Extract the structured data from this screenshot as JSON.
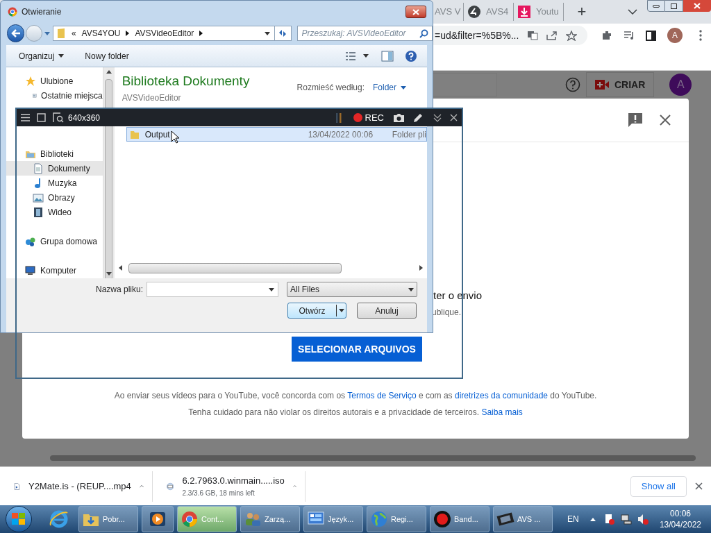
{
  "browser": {
    "tabs": [
      {
        "label": "AVS V",
        "kind": "plain",
        "selected": false
      },
      {
        "label": "AVS4",
        "kind": "badge",
        "selected": false
      },
      {
        "label": "Youtu",
        "kind": "download",
        "selected": false
      }
    ],
    "new_tab": "+",
    "url": "=ud&filter=%5B%...",
    "profile": "A"
  },
  "youtube": {
    "create_button": "CRIAR",
    "avatar": "A",
    "upload_dialog": {
      "line_1": "ter o envio",
      "line_2": "ublique.",
      "select_button": "SELECIONAR ARQUIVOS",
      "footer": [
        [
          {
            "kind": "text",
            "text": "Ao enviar seus vídeos para o YouTube, você concorda com os "
          },
          {
            "kind": "link",
            "text": "Termos de Serviço"
          },
          {
            "kind": "text",
            "text": " e com as "
          },
          {
            "kind": "link",
            "text": "diretrizes da comunidade"
          },
          {
            "kind": "text",
            "text": " do YouTube."
          }
        ],
        [
          {
            "kind": "text",
            "text": "Tenha cuidado para não violar os direitos autorais e a privacidade de terceiros. "
          },
          {
            "kind": "link",
            "text": "Saiba mais"
          }
        ]
      ]
    }
  },
  "open_dialog": {
    "title": "Otwieranie",
    "path_overflow": "«",
    "path": [
      "AVS4YOU",
      "AVSVideoEditor"
    ],
    "search_placeholder": "Przeszukaj: AVSVideoEditor",
    "toolbar": [
      "Organizuj",
      "Nowy folder"
    ],
    "nav": [
      {
        "label": "Ulubione",
        "kind": "star",
        "selected": false,
        "children": [
          {
            "label": "Ostatnie miejsca",
            "kind": "recent",
            "selected": false
          }
        ]
      },
      {
        "label": "Biblioteki",
        "kind": "library",
        "selected": false,
        "children": [
          {
            "label": "Dokumenty",
            "kind": "document",
            "selected": true
          },
          {
            "label": "Muzyka",
            "kind": "music",
            "selected": false
          },
          {
            "label": "Obrazy",
            "kind": "image",
            "selected": false
          },
          {
            "label": "Wideo",
            "kind": "video",
            "selected": false
          }
        ]
      },
      {
        "label": "Grupa domowa",
        "kind": "homegroup",
        "selected": false
      },
      {
        "label": "Komputer",
        "kind": "computer",
        "selected": false
      }
    ],
    "library_title": "Biblioteka Dokumenty",
    "library_subtitle": "AVSVideoEditor",
    "arrange_label": "Rozmieść według:",
    "arrange_value": "Folder",
    "files": [
      {
        "name": "Output",
        "date": "13/04/2022 00:06",
        "type": "Folder pli",
        "selected": true
      }
    ],
    "filename_label": "Nazwa pliku:",
    "filter": "All Files",
    "open_button": "Otwórz",
    "cancel_button": "Anuluj"
  },
  "recorder": {
    "size": "640x360",
    "rec": "REC"
  },
  "downloads": {
    "items": [
      {
        "name": "Y2Mate.is - (REUP....mp4",
        "kind": "video"
      },
      {
        "name": "6.2.7963.0.winmain.....iso",
        "kind": "disc",
        "status": "2.3/3.6 GB, 18 mins left"
      }
    ],
    "show_all": "Show all"
  },
  "taskbar": {
    "items": [
      {
        "label": "Pobr...",
        "kind": "folder",
        "selected": false
      },
      {
        "kind": "player",
        "selected": false
      },
      {
        "label": "Cont...",
        "kind": "chrome",
        "selected": true
      },
      {
        "label": "Zarzą...",
        "kind": "users",
        "selected": false
      },
      {
        "label": "Język...",
        "kind": "panel",
        "selected": false
      },
      {
        "label": "Regi...",
        "kind": "globe",
        "selected": false
      },
      {
        "label": "Band...",
        "kind": "record",
        "selected": false
      },
      {
        "label": "AVS ...",
        "kind": "film",
        "selected": false
      }
    ],
    "language": "EN",
    "time": "00:06",
    "date": "13/04/2022"
  }
}
